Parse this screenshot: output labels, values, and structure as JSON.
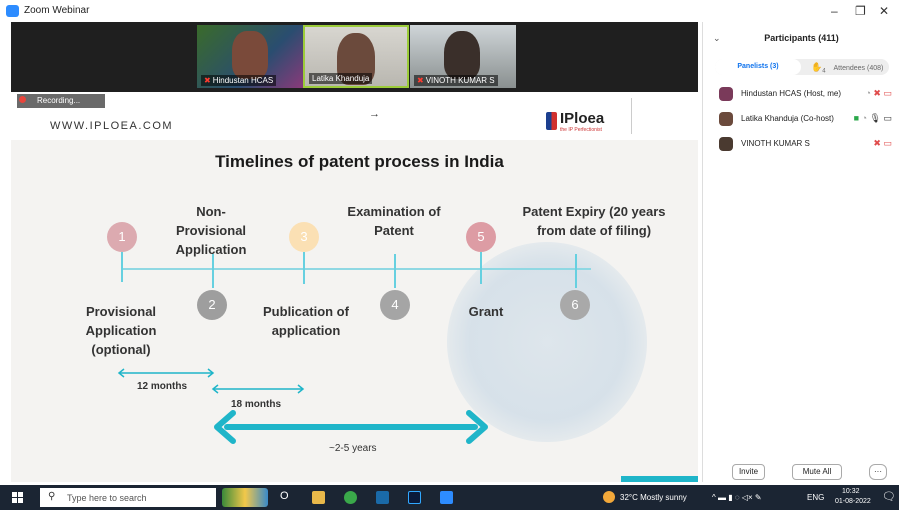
{
  "app": {
    "title": "Zoom Webinar"
  },
  "video_tiles": [
    {
      "name": "Hindustan HCAS",
      "muted": true
    },
    {
      "name": "Latika Khanduja",
      "muted": false
    },
    {
      "name": "VINOTH KUMAR S",
      "muted": true
    }
  ],
  "recording": {
    "label": "Recording..."
  },
  "slide": {
    "url": "WWW.IPLOEA.COM",
    "logo_text": "IPloea",
    "logo_tagline": "the IP Perfectionist",
    "arrow": "→",
    "title": "Timelines of patent process in India",
    "steps": [
      {
        "number": "1",
        "label": "Provisional Application (optional)"
      },
      {
        "number": "2",
        "label": "Non-Provisional Application"
      },
      {
        "number": "3",
        "label": "Publication of application"
      },
      {
        "number": "4",
        "label": "Examination of Patent"
      },
      {
        "number": "5",
        "label": "Grant"
      },
      {
        "number": "6",
        "label": "Patent Expiry (20 years from date of filing)"
      }
    ],
    "duration_12": "12 months",
    "duration_18": "18 months",
    "duration_total": "~2-5 years",
    "colors": {
      "step1": "#d9a5aa",
      "step2": "#9e9e9e",
      "step3": "#f8d9a8",
      "step4": "#a3a3a3",
      "step5": "#d99aa0",
      "step6": "#a8a8a8",
      "arrow": "#1fb5c9"
    }
  },
  "panel": {
    "title": "Participants (411)",
    "tab_panelists": "Panelists (3)",
    "tab_attendees": "Attendees (408)",
    "hand_count": "4",
    "participants": [
      {
        "name": "Hindustan HCAS (Host, me)"
      },
      {
        "name": "Latika Khanduja (Co-host)"
      },
      {
        "name": "VINOTH KUMAR S"
      }
    ],
    "invite_label": "Invite",
    "mute_all_label": "Mute All",
    "more_label": "···"
  },
  "taskbar": {
    "search_placeholder": "Type here to search",
    "weather": "32°C  Mostly sunny",
    "lang": "ENG",
    "time": "10:32",
    "date": "01-08-2022"
  }
}
